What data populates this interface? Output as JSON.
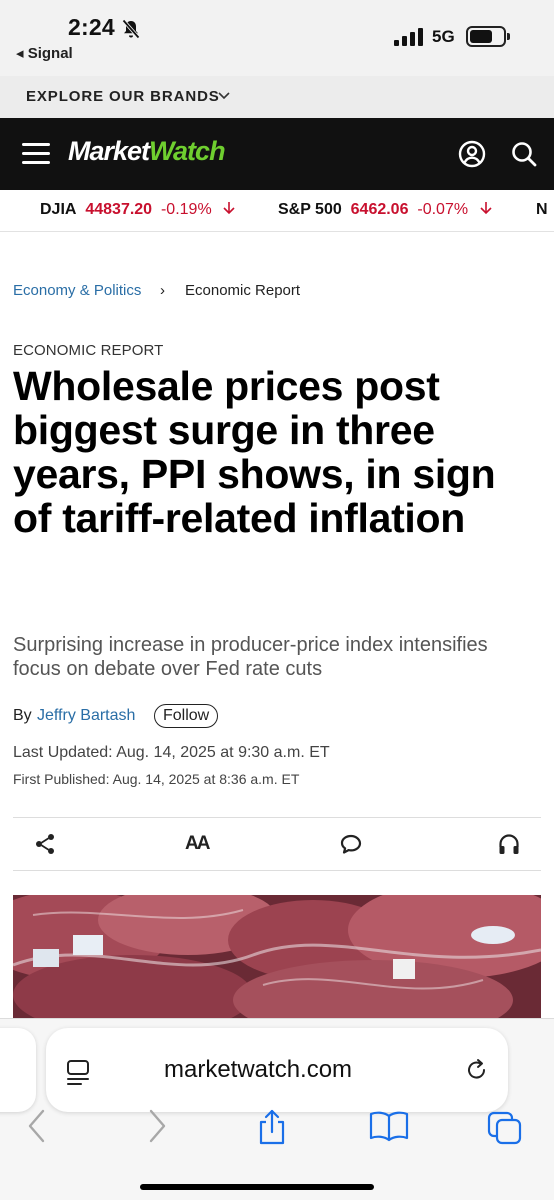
{
  "status_bar": {
    "time": "2:24",
    "back_app": "◂ Signal",
    "network": "5G"
  },
  "brands_bar": {
    "label": "EXPLORE OUR BRANDS"
  },
  "site": {
    "logo_market": "Market",
    "logo_watch": "Watch"
  },
  "ticker": [
    {
      "symbol": "DJIA",
      "value": "44837.20",
      "change": "-0.19%"
    },
    {
      "symbol": "S&P 500",
      "value": "6462.06",
      "change": "-0.07%"
    }
  ],
  "breadcrumb": {
    "section": "Economy & Politics",
    "separator": "›",
    "current": "Economic Report"
  },
  "article": {
    "kicker": "ECONOMIC REPORT",
    "headline": "Wholesale prices post biggest surge in three years, PPI shows, in sign of tariff-related inflation",
    "dek": "Surprising increase in producer-price index intensifies focus on debate over Fed rate cuts",
    "by": "By",
    "author": "Jeffry Bartash",
    "follow_label": "Follow",
    "last_updated": "Last Updated: Aug. 14, 2025 at 9:30 a.m. ET",
    "first_published": "First Published: Aug. 14, 2025 at 8:36 a.m. ET"
  },
  "tools": {
    "text_size_label": "AA"
  },
  "browser": {
    "url": "marketwatch.com"
  },
  "colors": {
    "nav_bg": "#111111",
    "logo_accent": "#6fcf2f",
    "negative": "#c8102e",
    "link": "#2a6ea6",
    "safari_blue": "#1a6fe8"
  },
  "icons": [
    "bell-slash-icon",
    "cellular-signal-icon",
    "battery-icon",
    "chevron-down-icon",
    "menu-icon",
    "user-icon",
    "search-icon",
    "down-arrow-icon",
    "share-icon",
    "text-size-icon",
    "comment-icon",
    "headphones-icon",
    "reader-icon",
    "reload-icon",
    "back-icon",
    "forward-icon",
    "share-sheet-icon",
    "bookmarks-icon",
    "tabs-icon"
  ]
}
